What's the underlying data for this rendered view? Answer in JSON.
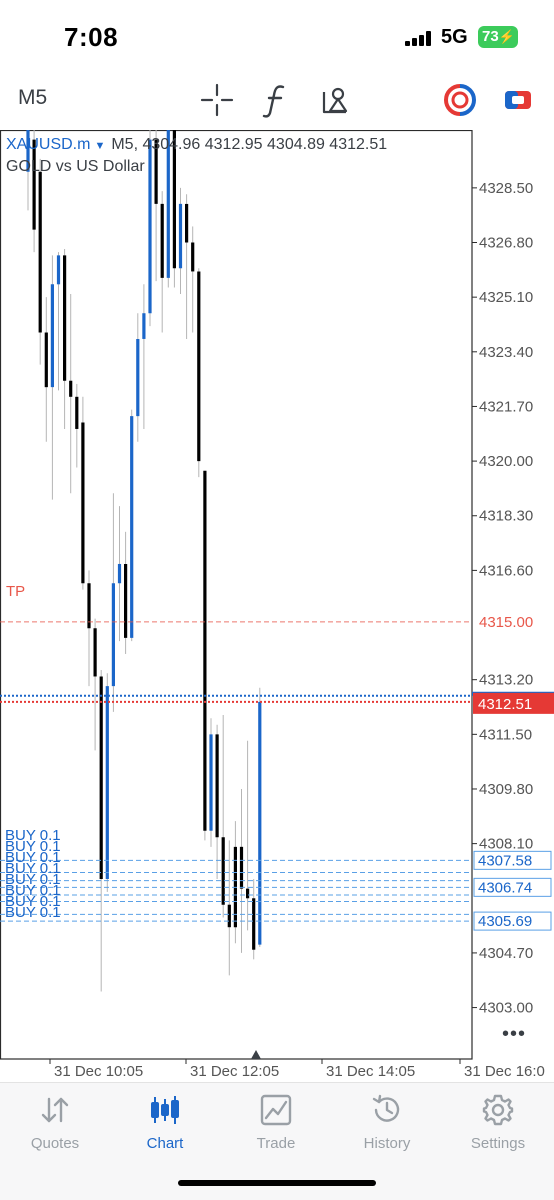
{
  "status_bar": {
    "time": "7:08",
    "network": "5G",
    "battery": "73"
  },
  "toolbar": {
    "timeframe": "M5",
    "icons": [
      "crosshair-icon",
      "function-icon",
      "objects-icon",
      "one-click-trading-icon",
      "trade-toggle-icon"
    ]
  },
  "chart": {
    "symbol": "XAUUSD.m",
    "quote_line": "M5, 4304.96 4312.95 4304.89 4312.51",
    "description": "GOLD vs US Dollar",
    "tp_label": "TP",
    "buy_labels": [
      "BUY 0.1",
      "BUY 0.1",
      "BUY 0.1",
      "BUY 0.1",
      "BUY 0.1",
      "BUY 0.1",
      "BUY 0.1",
      "BUY 0.1"
    ],
    "more": "•••"
  },
  "chart_data": {
    "type": "candlestick",
    "symbol": "XAUUSD.m",
    "timeframe": "M5",
    "ohlc": {
      "open": 4304.96,
      "high": 4312.95,
      "low": 4304.89,
      "close": 4312.51
    },
    "y_ticks": [
      "4328.50",
      "4326.80",
      "4325.10",
      "4323.40",
      "4321.70",
      "4320.00",
      "4318.30",
      "4316.60",
      "4313.20",
      "4311.50",
      "4309.80",
      "4308.10",
      "4304.70",
      "4303.00"
    ],
    "ylim": [
      4301.4,
      4330.3
    ],
    "x_ticks": [
      "31 Dec 10:05",
      "31 Dec 12:05",
      "31 Dec 14:05",
      "31 Dec 16:0"
    ],
    "levels": {
      "tp": 4315.0,
      "bid": 4312.51,
      "ask": 4312.7,
      "buy_orders": [
        4307.58,
        4307.2,
        4306.95,
        4306.74,
        4306.5,
        4306.3,
        4305.9,
        4305.69
      ]
    },
    "level_labels": {
      "tp": "4315.00",
      "bid": "4312.51",
      "buy_top": "4307.58",
      "buy_mid": "4306.74",
      "buy_bottom": "4305.69"
    },
    "candles": [
      [
        4331,
        4331,
        4327.8,
        4329.0,
        "bull"
      ],
      [
        4330,
        4330.3,
        4326.5,
        4327.2,
        "bear"
      ],
      [
        4329,
        4329.4,
        4323.0,
        4324.0,
        "bear"
      ],
      [
        4324,
        4325.1,
        4320.6,
        4322.3,
        "bear"
      ],
      [
        4322.3,
        4326.4,
        4318.8,
        4325.5,
        "bull"
      ],
      [
        4325.5,
        4326.5,
        4322.2,
        4326.4,
        "bull"
      ],
      [
        4326.4,
        4326.6,
        4321.0,
        4322.5,
        "bear"
      ],
      [
        4322.5,
        4325.2,
        4319.0,
        4322.0,
        "bear"
      ],
      [
        4322,
        4322.4,
        4319.8,
        4321.0,
        "bear"
      ],
      [
        4321.2,
        4322.0,
        4316.0,
        4316.2,
        "bear"
      ],
      [
        4316.2,
        4316.6,
        4313.0,
        4314.8,
        "bear"
      ],
      [
        4314.8,
        4315.1,
        4311.0,
        4313.3,
        "bear"
      ],
      [
        4313.3,
        4313.5,
        4303.5,
        4307.0,
        "bear"
      ],
      [
        4307,
        4313.4,
        4306.6,
        4313.0,
        "bull"
      ],
      [
        4313,
        4319.0,
        4312.2,
        4316.2,
        "bull"
      ],
      [
        4316.2,
        4318.6,
        4314.4,
        4316.8,
        "bull"
      ],
      [
        4316.8,
        4317.8,
        4314.0,
        4314.5,
        "bear"
      ],
      [
        4314.5,
        4321.6,
        4314.4,
        4321.4,
        "bull"
      ],
      [
        4321.4,
        4324.6,
        4320.6,
        4323.8,
        "bull"
      ],
      [
        4323.8,
        4325.5,
        4321.0,
        4324.6,
        "bull"
      ],
      [
        4324.6,
        4331.0,
        4324.2,
        4330.0,
        "bull"
      ],
      [
        4330,
        4330.6,
        4325.6,
        4328.0,
        "bear"
      ],
      [
        4328,
        4328.4,
        4324.0,
        4325.7,
        "bear"
      ],
      [
        4325.7,
        4331.0,
        4325.4,
        4330.5,
        "bull"
      ],
      [
        4330.5,
        4330.7,
        4325.4,
        4326.0,
        "bear"
      ],
      [
        4326,
        4328.5,
        4325.2,
        4328.0,
        "bull"
      ],
      [
        4328,
        4328.3,
        4323.8,
        4326.8,
        "bear"
      ],
      [
        4326.8,
        4327.3,
        4324.0,
        4325.9,
        "bear"
      ],
      [
        4325.9,
        4326.0,
        4319.5,
        4320.0,
        "bear"
      ],
      [
        4319.7,
        4319.7,
        4308.2,
        4308.5,
        "bear"
      ],
      [
        4308.5,
        4312.0,
        4308.0,
        4311.5,
        "bull"
      ],
      [
        4311.5,
        4311.8,
        4307.0,
        4308.3,
        "bear"
      ],
      [
        4308.3,
        4312.1,
        4305.8,
        4306.2,
        "bear"
      ],
      [
        4306.2,
        4308.2,
        4304.0,
        4305.5,
        "bear"
      ],
      [
        4305.5,
        4308.8,
        4305.0,
        4308.0,
        "bear"
      ],
      [
        4308,
        4309.8,
        4304.7,
        4306.7,
        "bear"
      ],
      [
        4306.7,
        4311.3,
        4305.4,
        4306.4,
        "bear"
      ],
      [
        4306.4,
        4307.0,
        4304.5,
        4304.8,
        "bear"
      ],
      [
        4304.96,
        4312.95,
        4304.89,
        4312.51,
        "bull"
      ]
    ]
  },
  "bottom_nav": {
    "items": [
      {
        "label": "Quotes",
        "icon": "quotes-arrows-icon",
        "active": false
      },
      {
        "label": "Chart",
        "icon": "chart-candles-icon",
        "active": true
      },
      {
        "label": "Trade",
        "icon": "trade-chart-icon",
        "active": false
      },
      {
        "label": "History",
        "icon": "history-clock-icon",
        "active": false
      },
      {
        "label": "Settings",
        "icon": "settings-gear-icon",
        "active": false
      }
    ]
  },
  "colors": {
    "accent": "#1b66c9",
    "bear": "#000000",
    "bull": "#1b66c9",
    "tp": "#e8574a",
    "bid_box": "#e53935",
    "buy_line": "#5aa0e6",
    "axis_text": "#555555"
  }
}
